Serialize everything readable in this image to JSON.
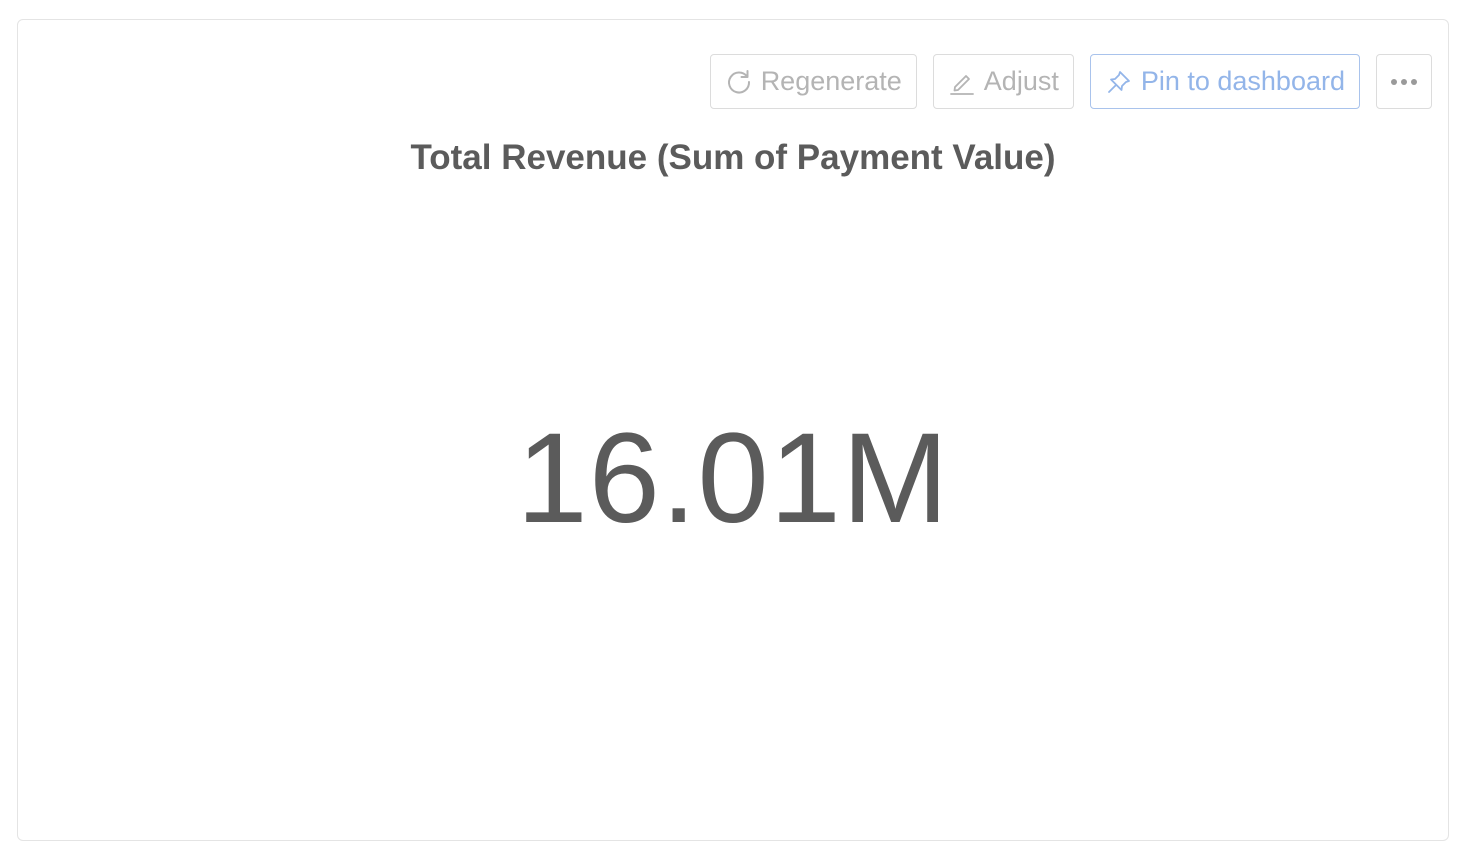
{
  "toolbar": {
    "regenerate_label": "Regenerate",
    "adjust_label": "Adjust",
    "pin_label": "Pin to dashboard",
    "more_label": "More options",
    "icons": {
      "regenerate": "refresh-icon",
      "adjust": "pencil-icon",
      "pin": "pin-icon",
      "more": "more-horizontal-icon"
    }
  },
  "card": {
    "title": "Total Revenue (Sum of Payment Value)",
    "value": "16.01M"
  },
  "colors": {
    "text": "#5b5b5b",
    "muted": "#b4b4b4",
    "accent": "#93b5e9",
    "border": "#dcdcdc"
  }
}
